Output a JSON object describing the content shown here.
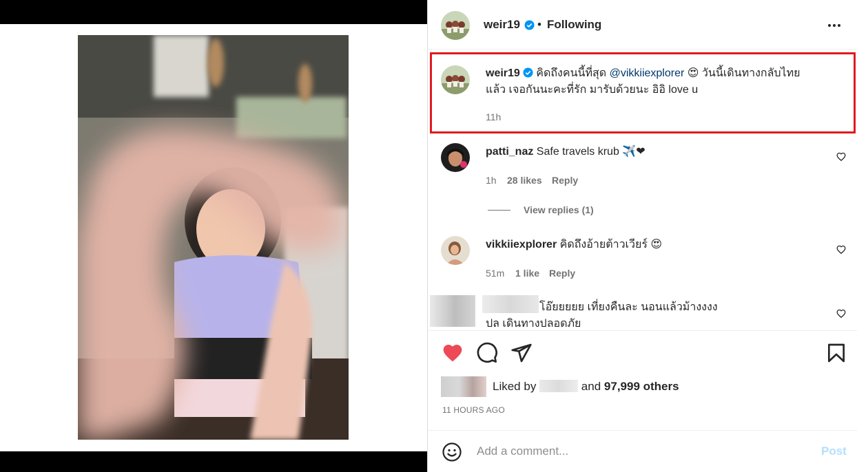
{
  "header": {
    "username": "weir19",
    "separator": "•",
    "follow_status": "Following"
  },
  "caption": {
    "username": "weir19",
    "text_before_mention": "คิดถึงคนนี้ที่สุด",
    "mention": "@vikkiiexplorer",
    "emoji": "😍",
    "text_after_emoji": "วันนี้เดินทางกลับไทย",
    "text_line2": "แล้ว เจอกันนะคะที่รัก มารับด้วยนะ อิอิ love u",
    "time": "11h"
  },
  "comments": [
    {
      "username": "patti_naz",
      "text": "Safe travels krub",
      "emoji": "✈️❤",
      "time": "1h",
      "likes": "28 likes",
      "reply": "Reply",
      "view_replies": "View replies (1)"
    },
    {
      "username": "vikkiiexplorer",
      "text": "คิดถึงอ้ายต้าวเวียร์",
      "emoji": "😍",
      "time": "51m",
      "likes": "1 like",
      "reply": "Reply"
    },
    {
      "text_line1": "โอ๊ยยยยย เที่ยงคืนละ นอนแล้วม้างงงง",
      "text_line2": "ปล เดินทางปลอดภัย"
    }
  ],
  "likes": {
    "prefix": "Liked by",
    "middle": "and",
    "count": "97,999 others"
  },
  "timestamp": "11 HOURS AGO",
  "add_comment": {
    "placeholder": "Add a comment...",
    "post_label": "Post"
  },
  "icons": {
    "like": "heart-filled-icon",
    "comment": "comment-bubble-icon",
    "share": "paper-plane-icon",
    "save": "bookmark-icon",
    "emoji": "smiley-icon",
    "more": "more-horizontal-icon"
  },
  "colors": {
    "like_red": "#ed4956",
    "mention_blue": "#00376b",
    "verified_blue": "#0095f6",
    "highlight_box": "#e0191f",
    "post_disabled": "#b2dffc"
  }
}
